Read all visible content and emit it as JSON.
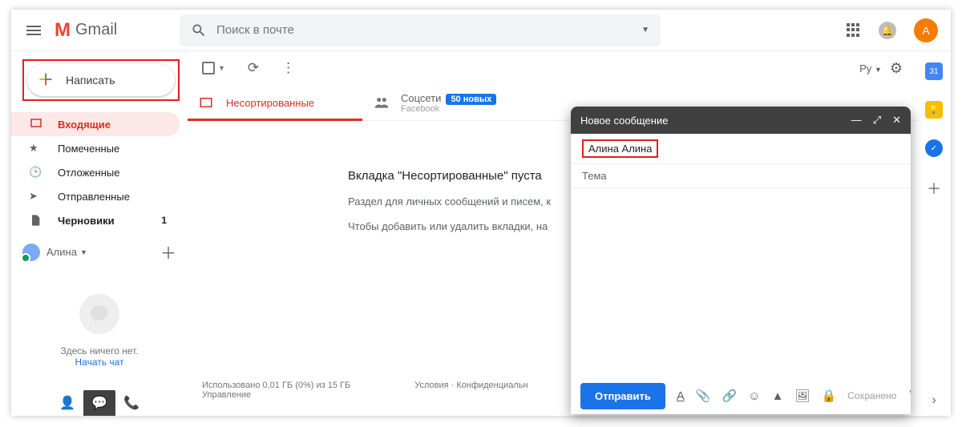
{
  "header": {
    "brand": "Gmail",
    "search_placeholder": "Поиск в почте",
    "avatar_letter": "А"
  },
  "compose_button": "Написать",
  "sidebar": {
    "items": [
      {
        "label": "Входящие",
        "active": true
      },
      {
        "label": "Помеченные"
      },
      {
        "label": "Отложенные"
      },
      {
        "label": "Отправленные"
      },
      {
        "label": "Черновики",
        "count": "1",
        "bold": true
      }
    ],
    "user": "Алина",
    "hangouts_empty": "Здесь ничего нет.",
    "hangouts_link": "Начать чат"
  },
  "toolbar": {
    "lang": "Ру"
  },
  "tabs": [
    {
      "label": "Несортированные"
    },
    {
      "label": "Соцсети",
      "badge": "50 новых",
      "sub": "Facebook"
    }
  ],
  "empty": {
    "title": "Вкладка \"Несортированные\" пуста",
    "line1": "Раздел для личных сообщений и писем, к",
    "line2": "Чтобы добавить или удалить вкладки, на"
  },
  "footer": {
    "storage1": "Использовано 0,01 ГБ (0%) из 15 ГБ",
    "storage2": "Управление",
    "terms": "Условия",
    "privacy": "Конфиденциальн"
  },
  "compose_win": {
    "title": "Новое сообщение",
    "recipient": "Алина Алина",
    "subject_placeholder": "Тема",
    "send": "Отправить",
    "saved": "Сохранено"
  },
  "rail_cal": "31"
}
